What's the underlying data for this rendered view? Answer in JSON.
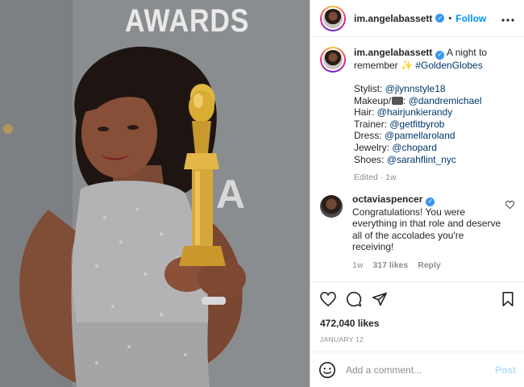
{
  "post": {
    "username": "im.angelabassett",
    "follow_label": "Follow",
    "separator": "•",
    "more_label": "•••",
    "backdrop_text": "AWARDS",
    "backdrop_letter": "A"
  },
  "caption": {
    "username": "im.angelabassett",
    "line1": "A night to remember",
    "sparkle": "✨",
    "hashtag": "#GoldenGlobes",
    "credits": [
      {
        "label": "Stylist: ",
        "handle": "@jlynnstyle18"
      },
      {
        "label": "Makeup/",
        "handle": "@dandremichael"
      },
      {
        "label": "Hair: ",
        "handle": "@hairjunkierandy"
      },
      {
        "label": "Trainer: ",
        "handle": "@getfitbyrob"
      },
      {
        "label": "Dress: ",
        "handle": "@pamellaroland"
      },
      {
        "label": "Jewelry: ",
        "handle": "@chopard"
      },
      {
        "label": "Shoes: ",
        "handle": "@sarahflint_nyc"
      }
    ],
    "meta": "Edited · 1w"
  },
  "comment": {
    "username": "octaviaspencer",
    "text": "Congratulations! You were everything in that role and deserve all of the accolades you're receiving!",
    "age": "1w",
    "likes": "317 likes",
    "reply_label": "Reply"
  },
  "stats": {
    "likes": "472,040 likes",
    "date": "JANUARY 12"
  },
  "add_comment": {
    "placeholder": "Add a comment...",
    "post_label": "Post"
  },
  "colors": {
    "link": "#00376b",
    "follow": "#0095f6",
    "verified": "#3897f0",
    "post_disabled": "#b2dffc",
    "muted": "#8e8e8e"
  },
  "icons": [
    "verified-badge-icon",
    "heart-icon",
    "comment-icon",
    "share-icon",
    "bookmark-icon",
    "emoji-icon",
    "more-icon"
  ]
}
